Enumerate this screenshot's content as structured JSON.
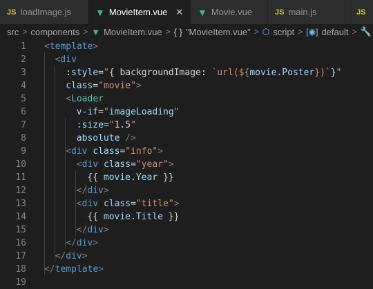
{
  "tabs": [
    {
      "label": "loadImage.js",
      "type": "js",
      "active": false
    },
    {
      "label": "MovieItem.vue",
      "type": "vue",
      "active": true
    },
    {
      "label": "Movie.vue",
      "type": "vue",
      "active": false
    },
    {
      "label": "main.js",
      "type": "js",
      "active": false
    },
    {
      "label": "",
      "type": "js",
      "active": false
    }
  ],
  "tab_icons": {
    "js": "JS",
    "vue": "▼",
    "close": "✕"
  },
  "breadcrumb": {
    "src": "src",
    "components": "components",
    "file": "MovieItem.vue",
    "braces": "{ }",
    "export_name": "\"MovieItem.vue\"",
    "script": "script",
    "default": "default",
    "sep": ">"
  },
  "colors": {
    "editor_bg": "#1e1e1e",
    "tag": "#569cd6",
    "component": "#4ec9b0",
    "attribute": "#9cdcfe",
    "string": "#ce9178",
    "vue_icon": "#41b883",
    "js_icon": "#cbcb41"
  },
  "editor": {
    "lines": [
      {
        "n": "1",
        "tokens": [
          [
            "pun",
            "<"
          ],
          [
            "tag",
            "template"
          ],
          [
            "pun",
            ">"
          ]
        ]
      },
      {
        "n": "2",
        "tokens": [
          [
            "pun",
            "<"
          ],
          [
            "tag",
            "div"
          ]
        ]
      },
      {
        "n": "3",
        "tokens": [
          [
            "attr",
            ":style"
          ],
          [
            "txt",
            "="
          ],
          [
            "str",
            "\""
          ],
          [
            "txt",
            "{ backgroundImage: "
          ],
          [
            "str",
            "`url(${"
          ],
          [
            "var",
            "movie"
          ],
          [
            "txt",
            "."
          ],
          [
            "var",
            "Poster"
          ],
          [
            "str",
            "})`"
          ],
          [
            "txt",
            "}"
          ],
          [
            "str",
            "\""
          ]
        ]
      },
      {
        "n": "4",
        "tokens": [
          [
            "attr",
            "class"
          ],
          [
            "txt",
            "="
          ],
          [
            "str",
            "\"movie\""
          ],
          [
            "pun",
            ">"
          ]
        ]
      },
      {
        "n": "5",
        "tokens": [
          [
            "pun",
            "<"
          ],
          [
            "cmp",
            "Loader"
          ]
        ]
      },
      {
        "n": "6",
        "tokens": [
          [
            "attr",
            "v-if"
          ],
          [
            "txt",
            "="
          ],
          [
            "str",
            "\""
          ],
          [
            "var",
            "imageLoading"
          ],
          [
            "str",
            "\""
          ]
        ]
      },
      {
        "n": "7",
        "tokens": [
          [
            "attr",
            ":size"
          ],
          [
            "txt",
            "="
          ],
          [
            "str",
            "\""
          ],
          [
            "txt",
            "1.5"
          ],
          [
            "str",
            "\""
          ]
        ]
      },
      {
        "n": "8",
        "tokens": [
          [
            "attr",
            "absolute"
          ],
          [
            "txt",
            " "
          ],
          [
            "pun",
            "/>"
          ]
        ]
      },
      {
        "n": "9",
        "tokens": [
          [
            "pun",
            "<"
          ],
          [
            "tag",
            "div"
          ],
          [
            "txt",
            " "
          ],
          [
            "attr",
            "class"
          ],
          [
            "txt",
            "="
          ],
          [
            "str",
            "\"info\""
          ],
          [
            "pun",
            ">"
          ]
        ]
      },
      {
        "n": "10",
        "tokens": [
          [
            "pun",
            "<"
          ],
          [
            "tag",
            "div"
          ],
          [
            "txt",
            " "
          ],
          [
            "attr",
            "class"
          ],
          [
            "txt",
            "="
          ],
          [
            "str",
            "\"year\""
          ],
          [
            "pun",
            ">"
          ]
        ]
      },
      {
        "n": "11",
        "tokens": [
          [
            "txt",
            "{{ "
          ],
          [
            "var",
            "movie"
          ],
          [
            "txt",
            "."
          ],
          [
            "var",
            "Year"
          ],
          [
            "txt",
            " }}"
          ]
        ]
      },
      {
        "n": "12",
        "tokens": [
          [
            "pun",
            "</"
          ],
          [
            "tag",
            "div"
          ],
          [
            "pun",
            ">"
          ]
        ]
      },
      {
        "n": "13",
        "tokens": [
          [
            "pun",
            "<"
          ],
          [
            "tag",
            "div"
          ],
          [
            "txt",
            " "
          ],
          [
            "attr",
            "class"
          ],
          [
            "txt",
            "="
          ],
          [
            "str",
            "\"title\""
          ],
          [
            "pun",
            ">"
          ]
        ]
      },
      {
        "n": "14",
        "tokens": [
          [
            "txt",
            "{{ "
          ],
          [
            "var",
            "movie"
          ],
          [
            "txt",
            "."
          ],
          [
            "var",
            "Title"
          ],
          [
            "txt",
            " }}"
          ]
        ]
      },
      {
        "n": "15",
        "tokens": [
          [
            "pun",
            "</"
          ],
          [
            "tag",
            "div"
          ],
          [
            "pun",
            ">"
          ]
        ]
      },
      {
        "n": "16",
        "tokens": [
          [
            "pun",
            "</"
          ],
          [
            "tag",
            "div"
          ],
          [
            "pun",
            ">"
          ]
        ]
      },
      {
        "n": "17",
        "tokens": [
          [
            "pun",
            "</"
          ],
          [
            "tag",
            "div"
          ],
          [
            "pun",
            ">"
          ]
        ]
      },
      {
        "n": "18",
        "tokens": [
          [
            "pun",
            "</"
          ],
          [
            "tag",
            "template"
          ],
          [
            "pun",
            ">"
          ]
        ]
      },
      {
        "n": "19",
        "tokens": []
      }
    ]
  }
}
